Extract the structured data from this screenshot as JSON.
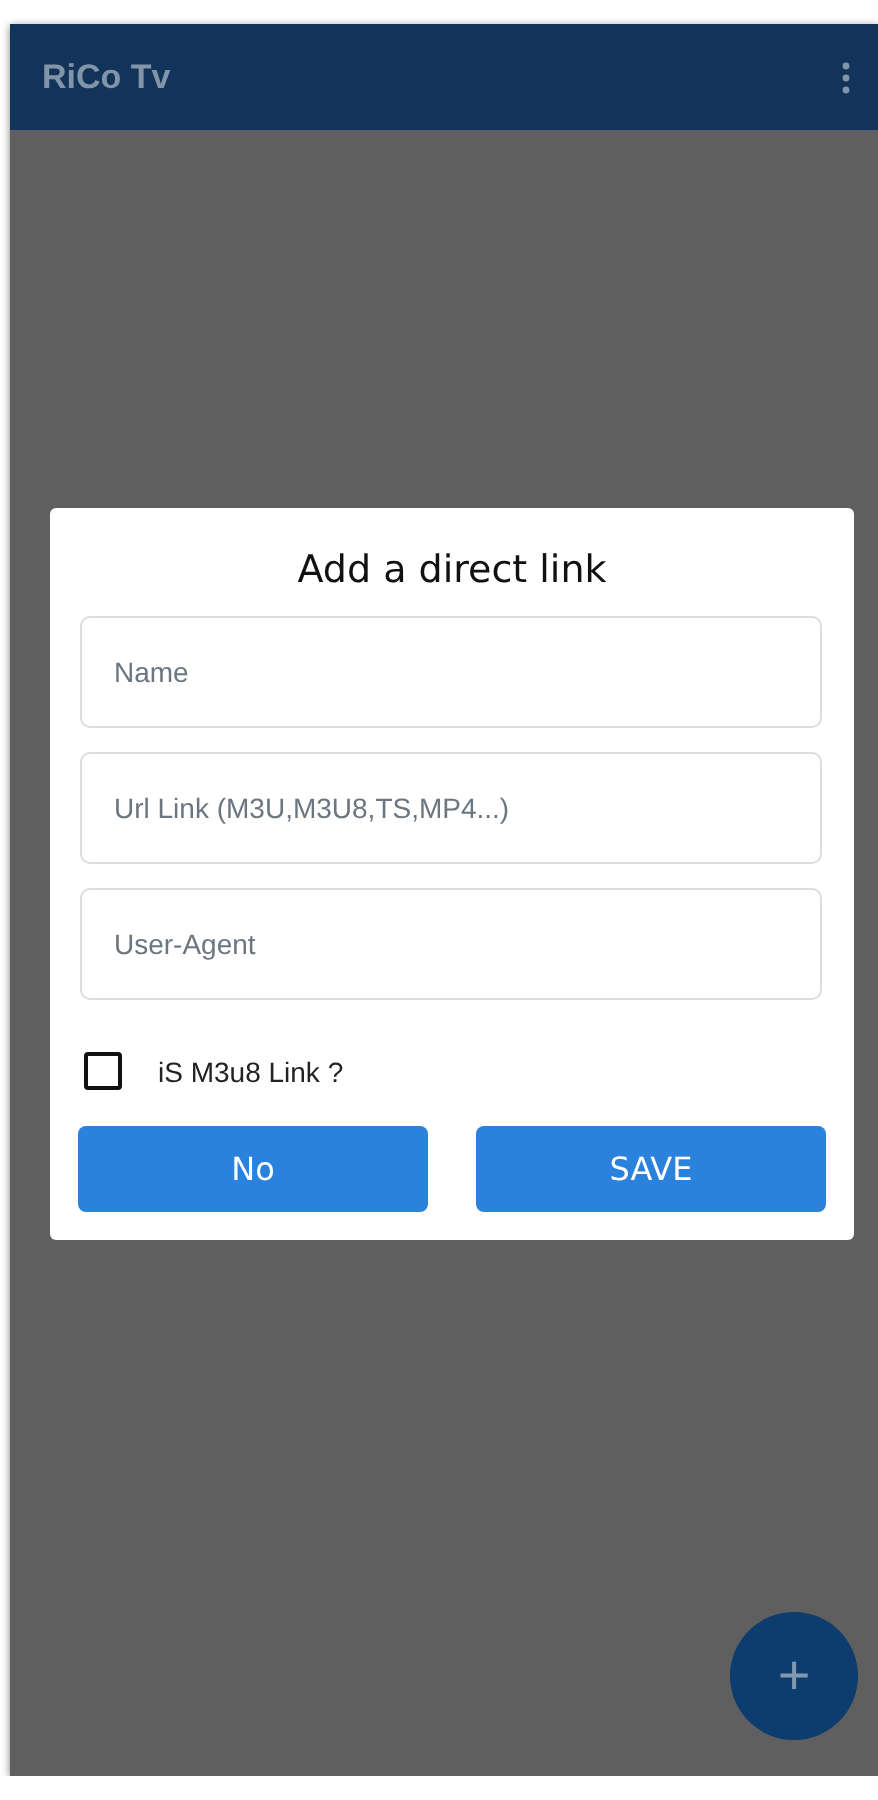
{
  "app_bar": {
    "title": "RiCo Tv"
  },
  "dialog": {
    "title": "Add a direct link",
    "fields": [
      {
        "placeholder": "Name"
      },
      {
        "placeholder": "Url Link (M3U,M3U8,TS,MP4...)"
      },
      {
        "placeholder": "User-Agent"
      }
    ],
    "checkbox": {
      "label": "iS M3u8 Link ?",
      "checked": false
    },
    "buttons": [
      "No",
      "SAVE"
    ]
  },
  "fab": {
    "label": "+"
  }
}
